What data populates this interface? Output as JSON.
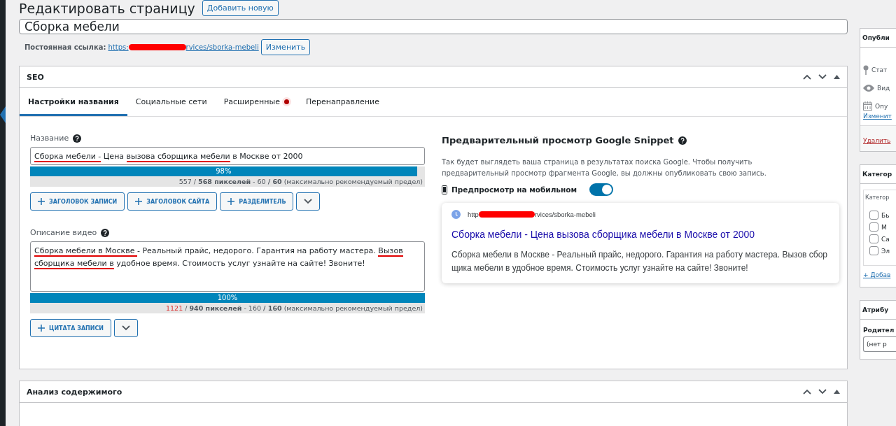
{
  "header": {
    "title": "Редактировать страницу",
    "add_button": "Добавить новую"
  },
  "post_title": {
    "value": "Сборка мебели"
  },
  "permalink": {
    "label": "Постоянная ссылка:",
    "url_start": "https:",
    "url_end": "rvices/sborka-mebeli",
    "button": "Изменить"
  },
  "seo_box": {
    "title": "SEO",
    "tabs": [
      {
        "label": "Настройки названия",
        "selected": true,
        "dot": false
      },
      {
        "label": "Социальные сети",
        "selected": false,
        "dot": false
      },
      {
        "label": "Расширенные",
        "selected": false,
        "dot": true
      },
      {
        "label": "Перенаправление",
        "selected": false,
        "dot": false
      }
    ],
    "title_field": {
      "label": "Название",
      "segments": [
        {
          "text": "Сборка мебели -",
          "marked": true
        },
        {
          "text": " Цена ",
          "marked": false
        },
        {
          "text": "вызова сборщика мебели",
          "marked": true
        },
        {
          "text": " в Москве от 2000",
          "marked": false
        }
      ],
      "progress": {
        "level": 0.98,
        "reading": "98%"
      },
      "count": "557",
      "over_limit": false,
      "stats": " / **568 пикселей** - 60 **/ 60** (максимально рекомендуемый предел)",
      "buttons": [
        "ЗАГОЛОВОК ЗАПИСИ",
        "ЗАГОЛОВОК САЙТА",
        "РАЗДЕЛИТЕЛЬ"
      ]
    },
    "description_field": {
      "label": "Описание видео",
      "segments": [
        {
          "text": "Сборка мебели в Москве ",
          "marked": true
        },
        {
          "text": "- Реальный прайс, недорого. Гарантия на работу мастера. ",
          "marked": false
        },
        {
          "text": "Вызов сборщика мебели в",
          "marked": true
        },
        {
          "text": " удобное время. Стоимость услуг узнайте на сайте! Звоните!",
          "marked": false
        }
      ],
      "progress": {
        "level": 1,
        "reading": "100%"
      },
      "count": "1121",
      "over_limit": true,
      "stats": " / **940 пикселей** - 160 **/ 160** (максимально рекомендуемый предел)",
      "buttons": [
        "ЦИТАТА ЗАПИСИ"
      ]
    },
    "preview": {
      "title": "Предварительный просмотр Google Snippet",
      "description": "Так будет выглядеть ваша страница в результатах поиска Google. Чтобы получить предварительный просмотр фрагмента Google, вы должны опубликовать свою запись.",
      "mobile_label": "Предпросмотр на мобильном",
      "mobile_on": true,
      "url_start": "http",
      "url_end": "rvices/sborka-mebeli",
      "snippet_title": "Сборка мебели - Цена вызова сборщика мебели в Москве от 2000",
      "snippet_text": "Сборка мебели в Москве - Реальный прайс, недорого. Гарантия на работу мастера. Вызов сбор щика мебели в удобное время. Стоимость услуг узнайте на сайте! Звоните!"
    }
  },
  "analysis_box": {
    "title": "Анализ содержимого"
  },
  "sidebar": {
    "publish": {
      "title": "Опубли",
      "rows": [
        {
          "kind": "pin",
          "text": "Стат"
        },
        {
          "kind": "eye",
          "text": "Вид"
        },
        {
          "kind": "calendar",
          "text": "Опу"
        }
      ],
      "change_link": "Изменит",
      "delete_link": "Удалить"
    },
    "categories": {
      "title": "Категор",
      "tab": "Категор",
      "items": [
        {
          "label": "Бь",
          "checked": false
        },
        {
          "label": "М",
          "checked": false
        },
        {
          "label": "Са",
          "checked": false
        },
        {
          "label": "Эл",
          "checked": false
        }
      ],
      "add_link": "+ Добав"
    },
    "attributes": {
      "title": "Атрибу",
      "parent_label": "Родител",
      "parent_value": "(нет р"
    }
  }
}
